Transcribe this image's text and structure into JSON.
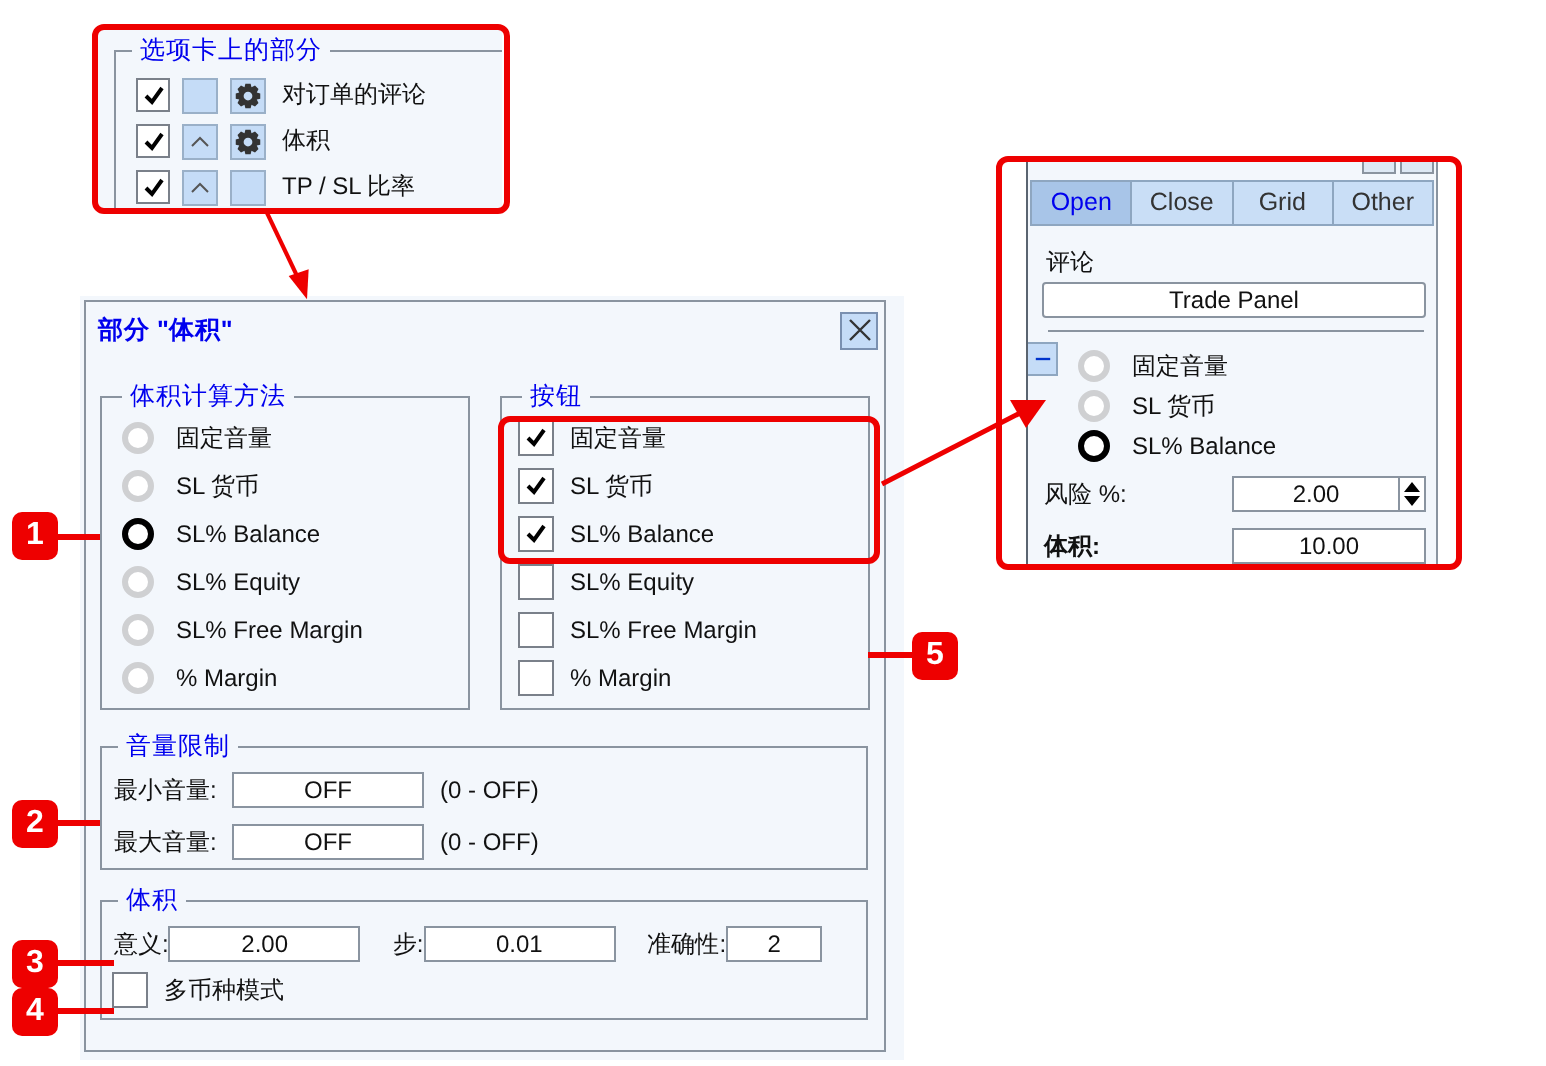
{
  "tab_sections_panel": {
    "title": "选项卡上的部分",
    "rows": [
      {
        "checked": true,
        "collapsible": false,
        "settings": true,
        "label": "对订单的评论"
      },
      {
        "checked": true,
        "collapsible": true,
        "settings": true,
        "label": "体积"
      },
      {
        "checked": true,
        "collapsible": true,
        "settings": false,
        "label": "TP / SL 比率"
      }
    ]
  },
  "dialog": {
    "title": "部分 \"体积\"",
    "method_group": {
      "title": "体积计算方法",
      "options": [
        {
          "label": "固定音量",
          "selected": false
        },
        {
          "label": "SL 货币",
          "selected": false
        },
        {
          "label": "SL% Balance",
          "selected": true
        },
        {
          "label": "SL% Equity",
          "selected": false
        },
        {
          "label": "SL% Free Margin",
          "selected": false
        },
        {
          "label": "% Margin",
          "selected": false
        }
      ]
    },
    "buttons_group": {
      "title": "按钮",
      "items": [
        {
          "label": "固定音量",
          "checked": true
        },
        {
          "label": "SL 货币",
          "checked": true
        },
        {
          "label": "SL% Balance",
          "checked": true
        },
        {
          "label": "SL% Equity",
          "checked": false
        },
        {
          "label": "SL% Free Margin",
          "checked": false
        },
        {
          "label": "% Margin",
          "checked": false
        }
      ]
    },
    "limits_group": {
      "title": "音量限制",
      "rows": [
        {
          "label": "最小音量:",
          "value": "OFF",
          "hint": "(0 - OFF)"
        },
        {
          "label": "最大音量:",
          "value": "OFF",
          "hint": "(0 - OFF)"
        }
      ]
    },
    "volume_group": {
      "title": "体积",
      "fields": [
        {
          "label": "意义:",
          "value": "2.00"
        },
        {
          "label": "步:",
          "value": "0.01"
        },
        {
          "label": "准确性:",
          "value": "2"
        }
      ],
      "multi_currency": {
        "label": "多币种模式",
        "checked": false
      }
    }
  },
  "trade_panel": {
    "tabs": [
      {
        "label": "Open",
        "selected": true
      },
      {
        "label": "Close",
        "selected": false
      },
      {
        "label": "Grid",
        "selected": false
      },
      {
        "label": "Other",
        "selected": false
      }
    ],
    "comment_label": "评论",
    "comment_value": "Trade Panel",
    "options": [
      {
        "label": "固定音量",
        "selected": false
      },
      {
        "label": "SL 货币",
        "selected": false
      },
      {
        "label": "SL% Balance",
        "selected": true
      }
    ],
    "risk": {
      "label": "风险 %:",
      "value": "2.00"
    },
    "volume": {
      "label": "体积:",
      "value": "10.00"
    }
  },
  "callouts": [
    "1",
    "2",
    "3",
    "4",
    "5"
  ]
}
